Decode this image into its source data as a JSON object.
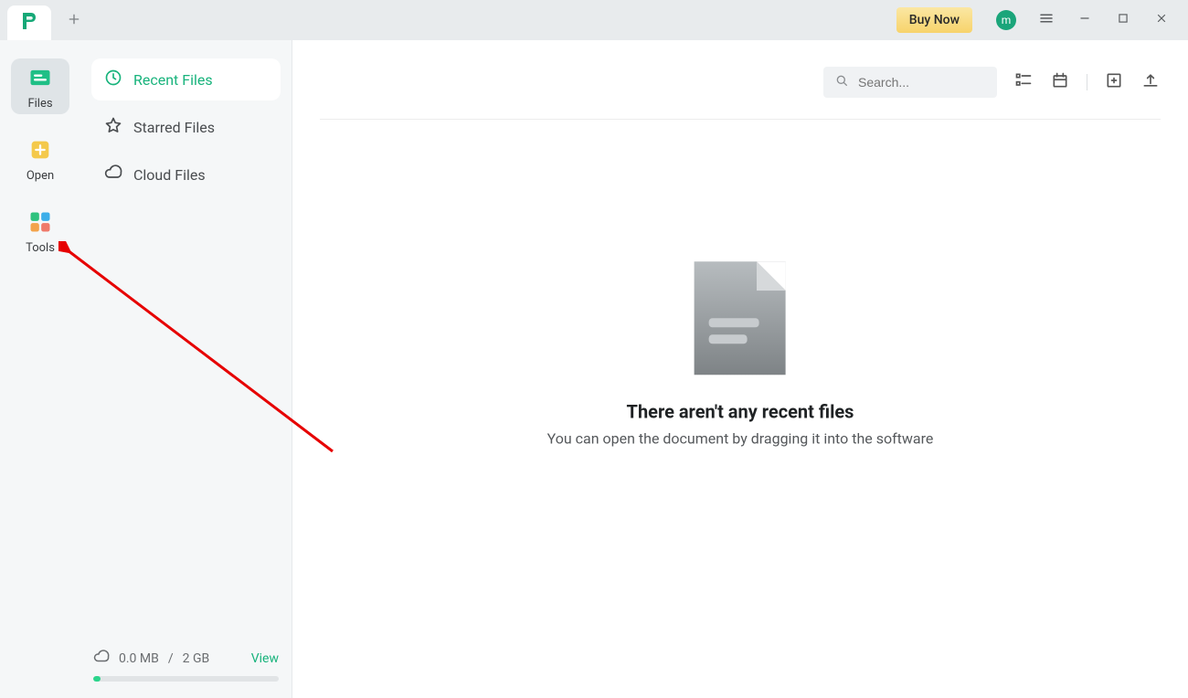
{
  "titlebar": {
    "buy_now": "Buy Now",
    "avatar_initial": "m"
  },
  "rail": {
    "items": [
      {
        "label": "Files"
      },
      {
        "label": "Open"
      },
      {
        "label": "Tools"
      }
    ]
  },
  "sidebar": {
    "items": [
      {
        "label": "Recent Files"
      },
      {
        "label": "Starred Files"
      },
      {
        "label": "Cloud Files"
      }
    ],
    "storage_used": "0.0 MB",
    "storage_sep": "/",
    "storage_total": "2 GB",
    "view_link": "View"
  },
  "content": {
    "search_placeholder": "Search...",
    "empty_title": "There aren't any recent files",
    "empty_subtitle": "You can open the document by dragging it into the software"
  }
}
